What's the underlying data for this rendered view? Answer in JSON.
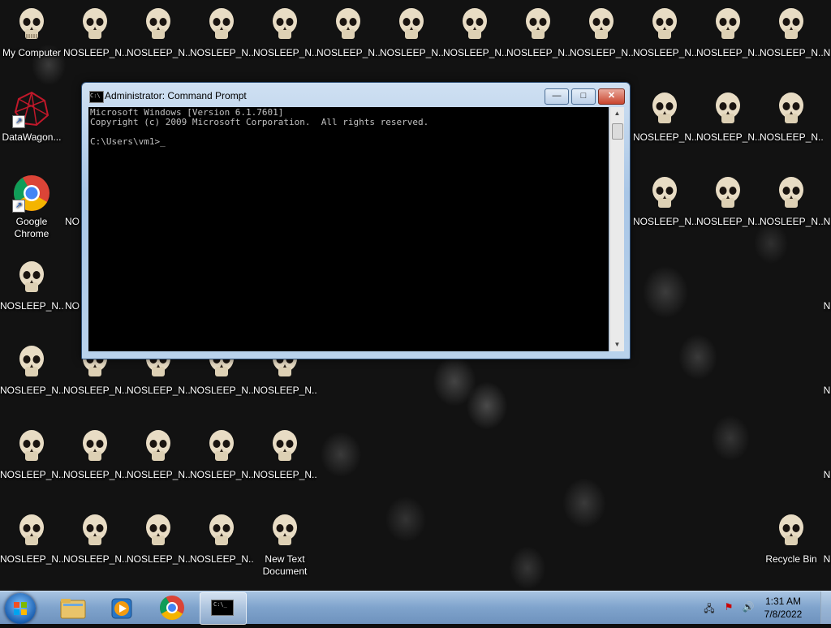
{
  "desktop": {
    "icons": {
      "my_computer": "My Computer",
      "nosleep": "NOSLEEP_N...",
      "datawagon": "DataWagon...",
      "chrome": "Google Chrome",
      "nosleep_partial": "NO",
      "nosleep_edge": "N",
      "new_text_doc": "New Text Document",
      "recycle_bin": "Recycle Bin"
    }
  },
  "cmd": {
    "title": "Administrator: Command Prompt",
    "line1": "Microsoft Windows [Version 6.1.7601]",
    "line2": "Copyright (c) 2009 Microsoft Corporation.  All rights reserved.",
    "prompt": "C:\\Users\\vm1>_",
    "icon_text": "C:\\",
    "minimize": "—",
    "maximize": "□",
    "close": "✕"
  },
  "taskbar": {
    "time": "1:31 AM",
    "date": "7/8/2022",
    "cmd_button_icon": "C:\\_"
  }
}
